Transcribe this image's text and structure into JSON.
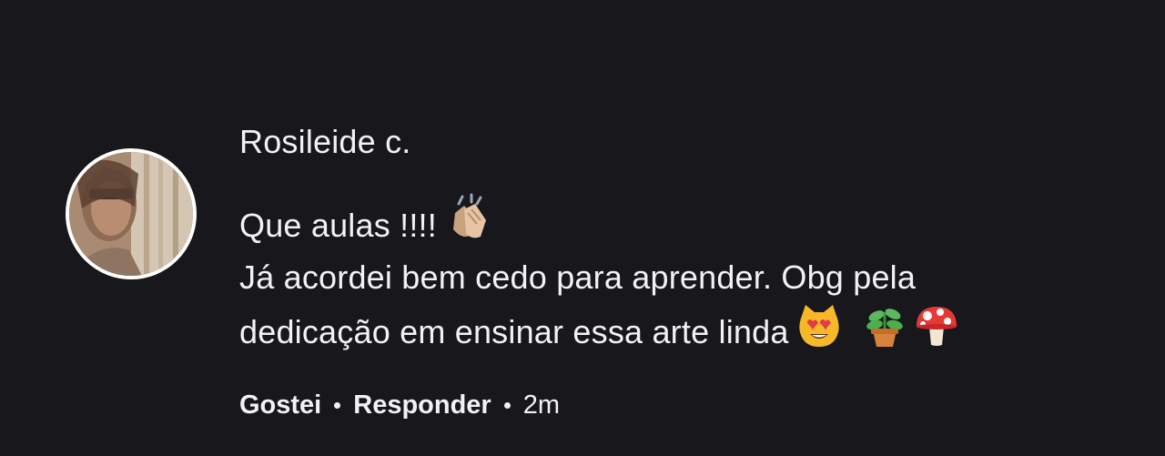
{
  "comment": {
    "author": "Rosileide c.",
    "lines": [
      "Que aulas !!!!",
      "Já acordei bem cedo para aprender. Obg pela",
      "dedicação em ensinar essa arte linda"
    ],
    "emojis": {
      "line1": [
        "clapping-hands-emoji"
      ],
      "line3": [
        "heart-eyes-cat-emoji",
        "potted-plant-emoji",
        "mushroom-emoji"
      ]
    },
    "actions": {
      "like_label": "Gostei",
      "reply_label": "Responder",
      "timestamp": "2m"
    }
  },
  "colors": {
    "background": "#17171c",
    "text": "#f2f2f4",
    "avatar_border": "#ffffff"
  }
}
